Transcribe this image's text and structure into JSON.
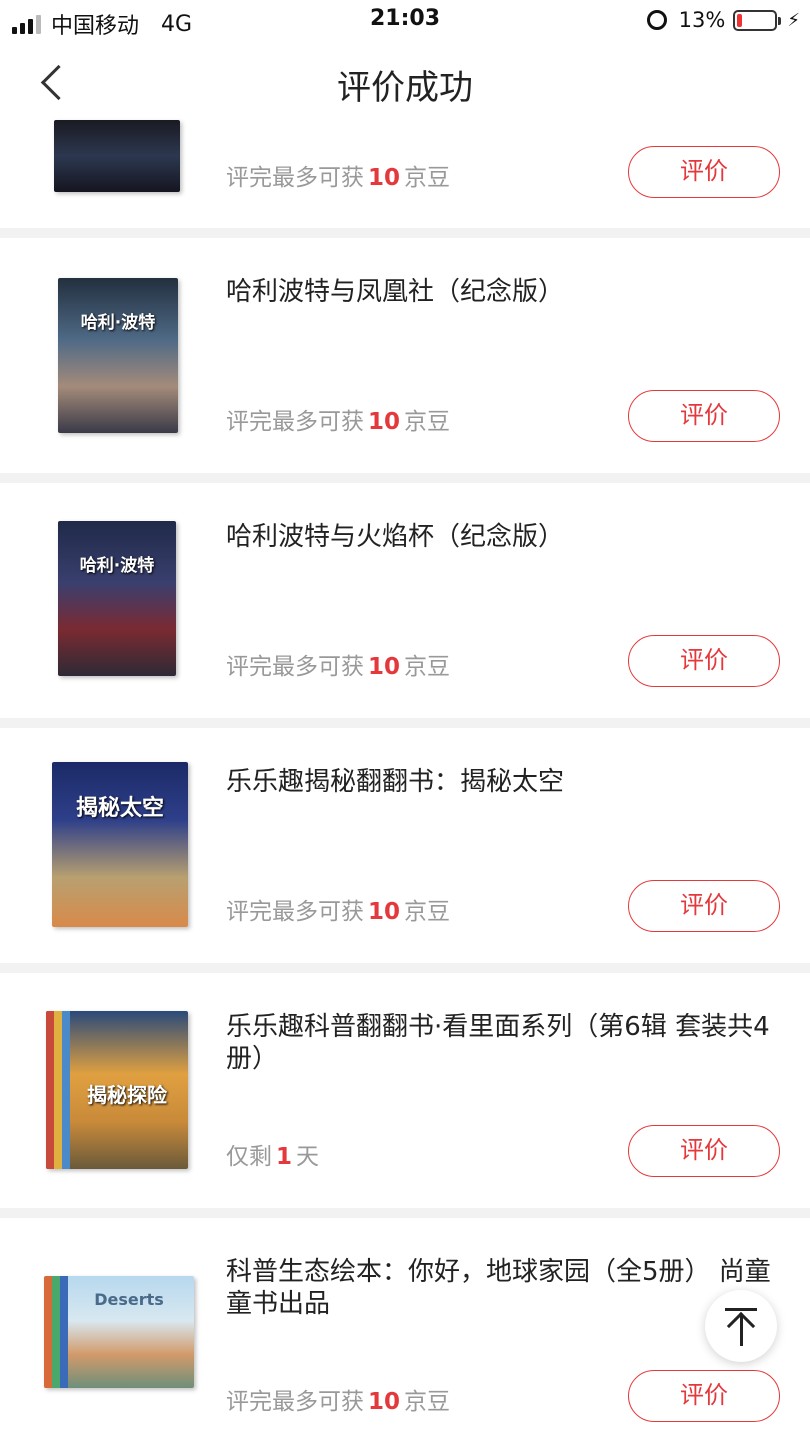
{
  "status_bar": {
    "carrier": "中国移动",
    "network": "4G",
    "time": "21:03",
    "battery": "13%",
    "battery_level": 0.13
  },
  "nav": {
    "title": "评价成功"
  },
  "reward_prefix": "评完最多可获",
  "reward_suffix": "京豆",
  "button_label": "评价",
  "items": [
    {
      "title": "",
      "cover_text": "",
      "reward_prefix": "评完最多可获",
      "reward_num": "10",
      "reward_suffix": "京豆"
    },
    {
      "title": "哈利波特与凤凰社（纪念版）",
      "cover_text": "哈利·波特",
      "reward_prefix": "评完最多可获",
      "reward_num": "10",
      "reward_suffix": "京豆"
    },
    {
      "title": "哈利波特与火焰杯（纪念版）",
      "cover_text": "哈利·波特",
      "reward_prefix": "评完最多可获",
      "reward_num": "10",
      "reward_suffix": "京豆"
    },
    {
      "title": "乐乐趣揭秘翻翻书：揭秘太空",
      "cover_text": "揭秘太空",
      "reward_prefix": "评完最多可获",
      "reward_num": "10",
      "reward_suffix": "京豆"
    },
    {
      "title": "乐乐趣科普翻翻书·看里面系列（第6辑 套装共4册）",
      "cover_text": "揭秘探险",
      "reward_prefix": "仅剩",
      "reward_num": "1",
      "reward_suffix": "天"
    },
    {
      "title": "科普生态绘本：你好，地球家园（全5册） 尚童童书出品",
      "cover_text": "Deserts",
      "reward_prefix": "评完最多可获",
      "reward_num": "10",
      "reward_suffix": "京豆"
    }
  ],
  "colors": {
    "accent": "#e4393c",
    "muted_text": "#999999",
    "divider": "#f2f2f2"
  }
}
